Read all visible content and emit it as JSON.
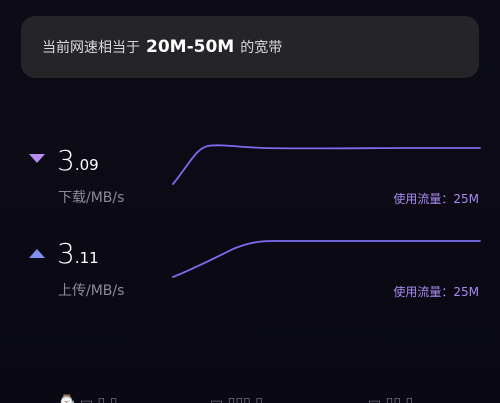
{
  "banner": {
    "prefix": "当前网速相当于",
    "highlight": "20M-50M",
    "suffix": "的宽带"
  },
  "download": {
    "speed_int": "3",
    "speed_dec": ".09",
    "unit": "下载/MB/s",
    "usage": "使用流量：25M",
    "arrow_color": "#b68cf0",
    "line_color": "#7b6cf0"
  },
  "upload": {
    "speed_int": "3",
    "speed_dec": ".11",
    "unit": "上传/MB/s",
    "usage": "使用流量：25M",
    "arrow_color": "#7f8ff5",
    "line_color": "#7b6cf0"
  },
  "accent_color": "#a88af2"
}
